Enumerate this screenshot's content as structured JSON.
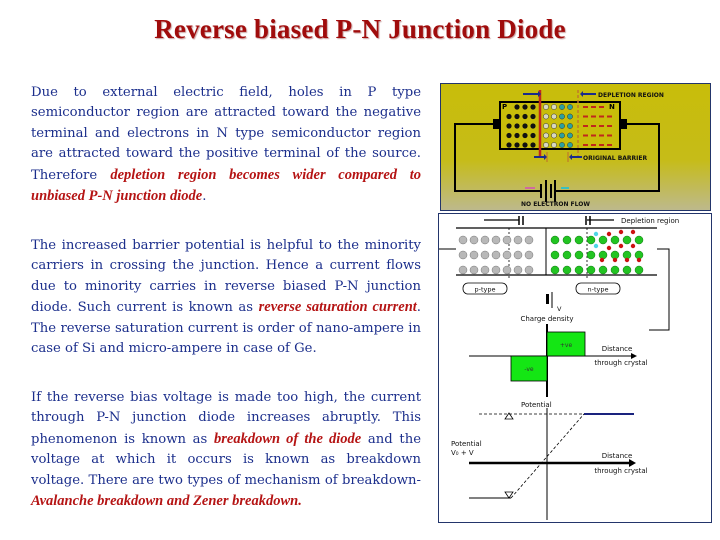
{
  "title": "Reverse biased P-N Junction Diode",
  "paragraphs": {
    "p1": {
      "text_1": "Due to external electric field, holes in P type semiconductor region are attracted toward the negative terminal and electrons in N type semiconductor region are attracted toward the positive terminal of the source. Therefore ",
      "emph_1": "depletion region becomes wider compared to unbiased P-N junction diode",
      "text_2": "."
    },
    "p2": {
      "text_1": "The increased barrier potential is helpful to the minority carriers in crossing the junction. Hence a current flows due to minority carries in reverse biased P-N junction diode. Such current is known as ",
      "emph_1": "reverse saturation current",
      "text_2": ". The reverse saturation current  is order of nano-ampere in case of Si and micro-ampere in case of Ge."
    },
    "p3": {
      "text_1": "If the reverse bias voltage is made too high, the current through P-N junction diode increases abruptly. This phenomenon is known as ",
      "emph_1": "breakdown of the diode",
      "text_2": " and the voltage at which it occurs is known as breakdown voltage. There are two types of mechanism of breakdown- ",
      "emph_2": "Avalanche breakdown and Zener breakdown."
    }
  },
  "figure_top": {
    "label_p": "P",
    "label_n": "N",
    "label_depletion": "DEPLETION REGION",
    "label_barrier": "ORIGINAL BARRIER",
    "label_flow": "NO ELECTRON FLOW",
    "colors": {
      "background": "#c8bd0a",
      "barrier": "#c0281c",
      "frame": "#23356b"
    }
  },
  "figure_bottom": {
    "label_depletion": "Depletion region",
    "label_p_type": "p-type",
    "label_n_type": "n-type",
    "label_v": "V",
    "charge_plot": {
      "ylabel": "Charge density",
      "xlabel_1": "Distance",
      "xlabel_2": "through crystal",
      "pos_label": "+ve",
      "neg_label": "-ve",
      "fill_color": "#14e614"
    },
    "potential_plot": {
      "ylabel": "Potential",
      "left_label_1": "Potential",
      "left_label_2": "V₀ + V",
      "xlabel_1": "Distance",
      "xlabel_2": "through crystal",
      "line_color": "#1a237e"
    }
  }
}
